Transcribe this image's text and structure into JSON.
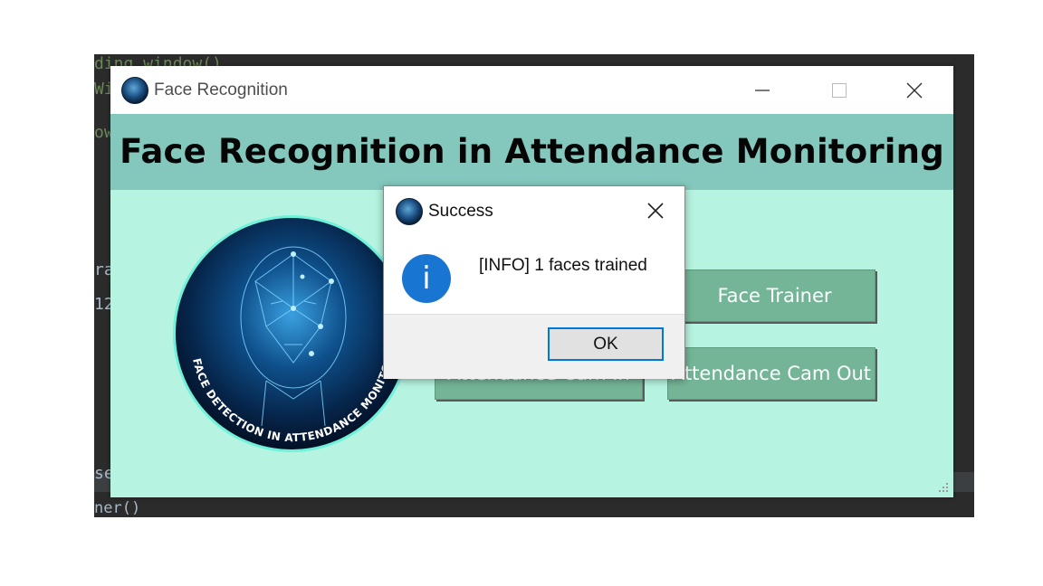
{
  "editor": {
    "lines": [
      "ding window()",
      "Wi",
      "ow",
      "ra",
      "12",
      "se",
      "ner()"
    ]
  },
  "window": {
    "title": "Face Recognition",
    "heading": "Face Recognition in Attendance Monitoring",
    "logo_text": "FACE DETECTION IN ATTENDANCE MONITORI",
    "buttons": {
      "face_trainer": "Face Trainer",
      "cam_in": "Attendance Cam In",
      "cam_out": "Attendance Cam Out"
    }
  },
  "dialog": {
    "title": "Success",
    "message": "[INFO] 1 faces trained",
    "ok_label": "OK",
    "icon": "info-icon"
  },
  "colors": {
    "header": "#84c8bd",
    "body": "#b6f3e0",
    "button": "#74b597",
    "accent": "#0078d7"
  }
}
